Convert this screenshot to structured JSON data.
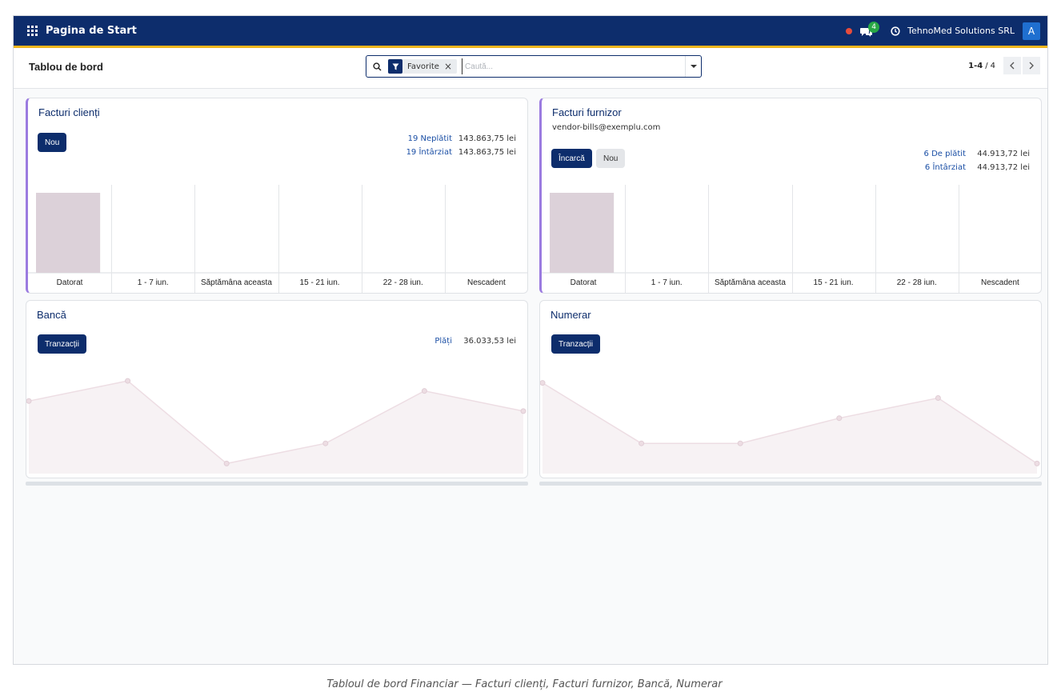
{
  "navbar": {
    "app_title": "Pagina de Start",
    "messages_count": "4",
    "company": "TehnoMed Solutions SRL",
    "avatar_initial": "A"
  },
  "control_panel": {
    "breadcrumb": "Tablou de bord",
    "search": {
      "facet_label": "Favorite",
      "placeholder": "Caută..."
    },
    "pager": {
      "value": "1-4",
      "separator": "/",
      "total": "4"
    }
  },
  "cards": {
    "customer_invoices": {
      "title": "Facturi clienți",
      "new_button": "Nou",
      "stats": [
        {
          "label": "19 Neplătit",
          "amount": "143.863,75 lei"
        },
        {
          "label": "19 Întârziat",
          "amount": "143.863,75 lei"
        }
      ]
    },
    "vendor_bills": {
      "title": "Facturi furnizor",
      "email": "vendor-bills@exemplu.com",
      "upload_button": "Încarcă",
      "new_button": "Nou",
      "stats": [
        {
          "label": "6 De plătit",
          "amount": "44.913,72 lei"
        },
        {
          "label": "6 Întârziat",
          "amount": "44.913,72 lei"
        }
      ]
    },
    "bank": {
      "title": "Bancă",
      "transactions_button": "Tranzacții",
      "stats": [
        {
          "label": "Plăți",
          "amount": "36.033,53 lei"
        }
      ]
    },
    "cash": {
      "title": "Numerar",
      "transactions_button": "Tranzacții"
    }
  },
  "colors": {
    "navbar": "#0d2d6c",
    "navbar_underline": "#f1b51c",
    "accent_border": "#9b7be0",
    "bar_fill": "#dcd1d9",
    "line_stroke": "#eddde3",
    "area_fill": "#f7f2f4"
  },
  "chart_data": [
    {
      "type": "bar",
      "chart": "customer_invoices",
      "categories": [
        "Datorat",
        "1 - 7 iun.",
        "Săptămâna aceasta",
        "15 - 21 iun.",
        "22 - 28 iun.",
        "Nescadent"
      ],
      "values": [
        100,
        0,
        0,
        0,
        0,
        0
      ],
      "ylim": [
        0,
        110
      ]
    },
    {
      "type": "bar",
      "chart": "vendor_bills",
      "categories": [
        "Datorat",
        "1 - 7 iun.",
        "Săptămâna aceasta",
        "15 - 21 iun.",
        "22 - 28 iun.",
        "Nescadent"
      ],
      "values": [
        100,
        0,
        0,
        0,
        0,
        0
      ],
      "ylim": [
        0,
        110
      ]
    },
    {
      "type": "area",
      "chart": "bank",
      "x": [
        0,
        1,
        2,
        3,
        4,
        5
      ],
      "values": [
        72,
        92,
        10,
        30,
        82,
        62
      ],
      "ylim": [
        0,
        100
      ]
    },
    {
      "type": "area",
      "chart": "cash",
      "x": [
        0,
        1,
        2,
        3,
        4,
        5
      ],
      "values": [
        90,
        30,
        30,
        55,
        75,
        10
      ],
      "ylim": [
        0,
        100
      ]
    }
  ]
}
